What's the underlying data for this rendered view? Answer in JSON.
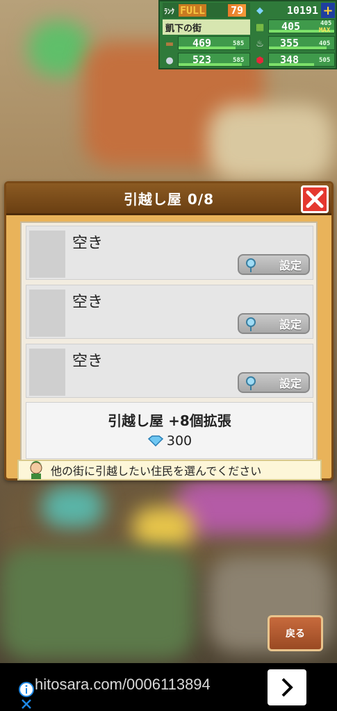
{
  "hud": {
    "rank_label": "ﾗﾝｸ",
    "full_label": "FULL",
    "rank_value": "79",
    "gems": "10191",
    "town_name": "凱下の街",
    "stat1": "405",
    "stat1_max": "405",
    "stat1_max_label": "MAX",
    "wood": "469",
    "wood_max": "585",
    "stat2": "355",
    "stat2_max": "405",
    "ore": "523",
    "ore_max": "585",
    "stat3": "348",
    "stat3_max": "505",
    "colors": {
      "bg": "#2f7a3a",
      "full": "#f5c542"
    }
  },
  "dialog": {
    "title": "引越し屋 0/8",
    "slots": [
      {
        "label": "空き",
        "button": "設定"
      },
      {
        "label": "空き",
        "button": "設定"
      },
      {
        "label": "空き",
        "button": "設定"
      }
    ],
    "expand_label": "引越し屋 +8個拡張",
    "expand_cost": "300",
    "hint": "他の街に引越したい住民を選んでください"
  },
  "back_button": "戻る",
  "ad": {
    "url": "hitosara.com/0006113894"
  }
}
